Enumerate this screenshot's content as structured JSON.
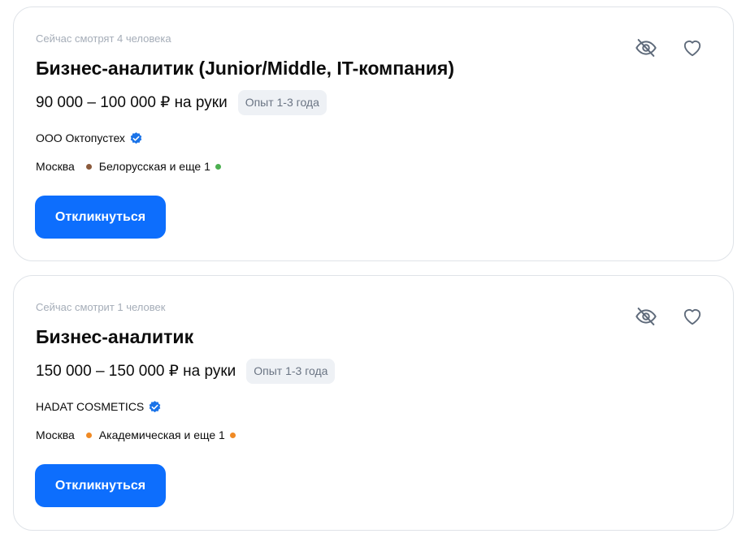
{
  "vacancies": [
    {
      "watchers": "Сейчас смотрят 4 человека",
      "title": "Бизнес-аналитик (Junior/Middle, IT-компания)",
      "salary": "90 000 – 100 000 ₽ на руки",
      "experience": "Опыт 1-3 года",
      "company": "ООО Октопустех",
      "city": "Москва",
      "metro": "Белорусская и еще 1",
      "metro_color": "#8b5a3c",
      "metro_color_2": "#4caf50",
      "apply_label": "Откликнуться"
    },
    {
      "watchers": "Сейчас смотрит 1 человек",
      "title": "Бизнес-аналитик",
      "salary": "150 000 – 150 000 ₽ на руки",
      "experience": "Опыт 1-3 года",
      "company": "HADAT COSMETICS",
      "city": "Москва",
      "metro": "Академическая и еще 1",
      "metro_color": "#f08a24",
      "metro_color_2": "#f08a24",
      "apply_label": "Откликнуться"
    }
  ],
  "icons": {
    "hide": "eye-off-icon",
    "favorite": "heart-icon",
    "verified": "verified-badge-icon"
  },
  "colors": {
    "accent": "#0d6efd",
    "verified": "#1a73e8"
  }
}
